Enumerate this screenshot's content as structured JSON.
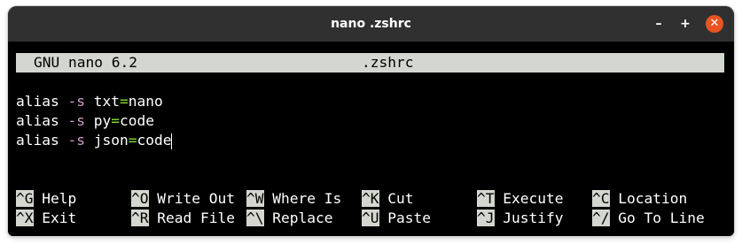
{
  "window": {
    "title": "nano .zshrc",
    "minimize_label": "–",
    "maximize_label": "+",
    "close_label": "✕"
  },
  "header": {
    "version": "GNU nano 6.2",
    "filename": ".zshrc"
  },
  "editor": {
    "lines": [
      {
        "cmd": "alias",
        "flag": "-s",
        "ext": "txt",
        "eq": "=",
        "target": "nano"
      },
      {
        "cmd": "alias",
        "flag": "-s",
        "ext": "py",
        "eq": "=",
        "target": "code"
      },
      {
        "cmd": "alias",
        "flag": "-s",
        "ext": "json",
        "eq": "=",
        "target": "code"
      }
    ]
  },
  "shortcuts": {
    "row1": [
      {
        "key": "^G",
        "label": "Help"
      },
      {
        "key": "^O",
        "label": "Write Out"
      },
      {
        "key": "^W",
        "label": "Where Is"
      },
      {
        "key": "^K",
        "label": "Cut"
      },
      {
        "key": "^T",
        "label": "Execute"
      },
      {
        "key": "^C",
        "label": "Location"
      }
    ],
    "row2": [
      {
        "key": "^X",
        "label": "Exit"
      },
      {
        "key": "^R",
        "label": "Read File"
      },
      {
        "key": "^\\",
        "label": "Replace"
      },
      {
        "key": "^U",
        "label": "Paste"
      },
      {
        "key": "^J",
        "label": "Justify"
      },
      {
        "key": "^/",
        "label": "Go To Line"
      }
    ]
  }
}
